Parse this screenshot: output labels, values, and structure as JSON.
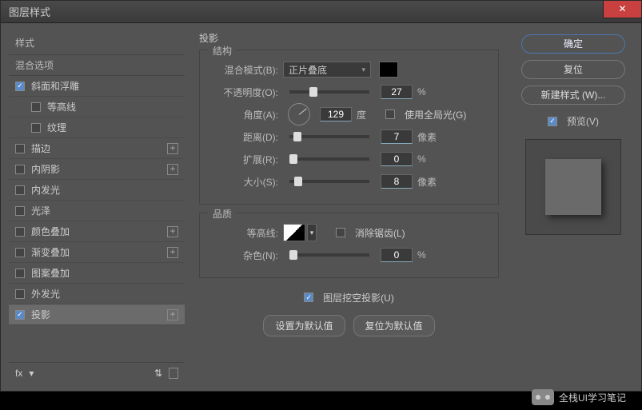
{
  "window": {
    "title": "图层样式"
  },
  "left": {
    "header": "样式",
    "sub": "混合选项",
    "effects": [
      {
        "label": "斜面和浮雕",
        "checked": true,
        "plus": false,
        "indent": false
      },
      {
        "label": "等高线",
        "checked": false,
        "plus": false,
        "indent": true
      },
      {
        "label": "纹理",
        "checked": false,
        "plus": false,
        "indent": true
      },
      {
        "label": "描边",
        "checked": false,
        "plus": true,
        "indent": false
      },
      {
        "label": "内阴影",
        "checked": false,
        "plus": true,
        "indent": false
      },
      {
        "label": "内发光",
        "checked": false,
        "plus": false,
        "indent": false
      },
      {
        "label": "光泽",
        "checked": false,
        "plus": false,
        "indent": false
      },
      {
        "label": "颜色叠加",
        "checked": false,
        "plus": true,
        "indent": false
      },
      {
        "label": "渐变叠加",
        "checked": false,
        "plus": true,
        "indent": false
      },
      {
        "label": "图案叠加",
        "checked": false,
        "plus": false,
        "indent": false
      },
      {
        "label": "外发光",
        "checked": false,
        "plus": false,
        "indent": false
      },
      {
        "label": "投影",
        "checked": true,
        "plus": true,
        "indent": false,
        "selected": true
      }
    ],
    "fx": "fx"
  },
  "center": {
    "title": "投影",
    "structure": {
      "legend": "结构",
      "blend_label": "混合模式(B):",
      "blend_value": "正片叠底",
      "opacity_label": "不透明度(O):",
      "opacity_value": "27",
      "opacity_unit": "%",
      "angle_label": "角度(A):",
      "angle_value": "129",
      "angle_unit": "度",
      "global_label": "使用全局光(G)",
      "global_checked": false,
      "distance_label": "距离(D):",
      "distance_value": "7",
      "distance_unit": "像素",
      "spread_label": "扩展(R):",
      "spread_value": "0",
      "spread_unit": "%",
      "size_label": "大小(S):",
      "size_value": "8",
      "size_unit": "像素"
    },
    "quality": {
      "legend": "品质",
      "contour_label": "等高线:",
      "antialias_label": "消除锯齿(L)",
      "antialias_checked": false,
      "noise_label": "杂色(N):",
      "noise_value": "0",
      "noise_unit": "%"
    },
    "knockout_label": "图层挖空投影(U)",
    "knockout_checked": true,
    "set_default": "设置为默认值",
    "reset_default": "复位为默认值"
  },
  "right": {
    "ok": "确定",
    "cancel": "复位",
    "newstyle": "新建样式 (W)...",
    "preview_label": "预览(V)",
    "preview_checked": true
  },
  "watermark": "全栈UI学习笔记"
}
